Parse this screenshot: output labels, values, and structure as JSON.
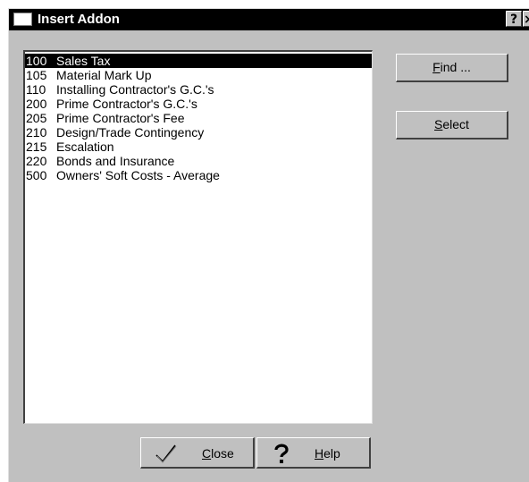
{
  "window": {
    "title": "Insert Addon",
    "help_glyph": "?",
    "close_glyph": "×"
  },
  "list": {
    "items": [
      {
        "code": "100",
        "label": "Sales Tax",
        "selected": true
      },
      {
        "code": "105",
        "label": "Material Mark Up"
      },
      {
        "code": "110",
        "label": "Installing Contractor's G.C.'s"
      },
      {
        "code": "200",
        "label": "Prime Contractor's G.C.'s"
      },
      {
        "code": "205",
        "label": "Prime Contractor's Fee"
      },
      {
        "code": "210",
        "label": "Design/Trade Contingency"
      },
      {
        "code": "215",
        "label": "Escalation"
      },
      {
        "code": "220",
        "label": "Bonds and Insurance"
      },
      {
        "code": "500",
        "label": "Owners' Soft Costs - Average"
      }
    ]
  },
  "buttons": {
    "find": {
      "accel": "F",
      "rest": "ind ..."
    },
    "select": {
      "accel": "S",
      "rest": "elect"
    },
    "close": {
      "accel": "C",
      "rest": "lose",
      "icon": "checkmark-icon"
    },
    "help": {
      "accel": "H",
      "rest": "elp",
      "icon": "question-mark-icon"
    }
  }
}
